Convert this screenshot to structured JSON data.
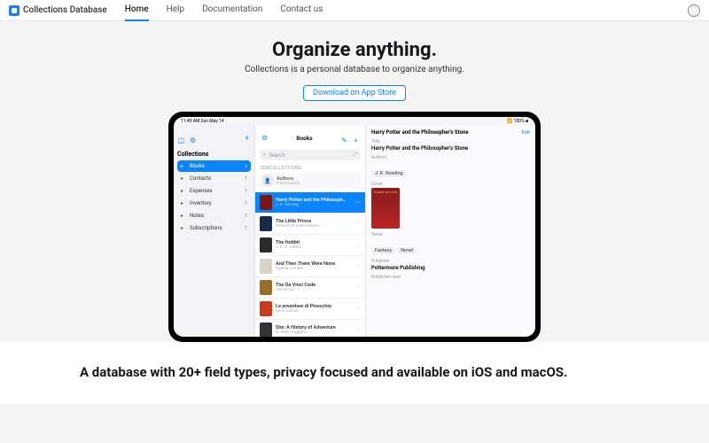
{
  "topbar": {
    "brand": "Collections Database",
    "nav": [
      "Home",
      "Help",
      "Documentation",
      "Contact us"
    ]
  },
  "hero": {
    "headline": "Organize anything.",
    "sub": "Collections is a personal database to organize anything.",
    "cta": "Download on App Store"
  },
  "status": {
    "time": "11:49 AM  Sun May 14",
    "battery": "100%"
  },
  "sidebar": {
    "title": "Collections",
    "items": [
      {
        "label": "Books",
        "count": "6"
      },
      {
        "label": "Contacts",
        "count": "1"
      },
      {
        "label": "Expenses",
        "count": "1"
      },
      {
        "label": "Inventory",
        "count": "1"
      },
      {
        "label": "Notes",
        "count": "1"
      },
      {
        "label": "Subscriptions",
        "count": "1"
      }
    ]
  },
  "mid": {
    "title": "Books",
    "search": "Search",
    "subhdr": "SUBCOLLECTIONS",
    "sub": {
      "name": "Authors",
      "meta": "6 documents"
    },
    "books": [
      {
        "t": "Harry Potter and the Philosoph…",
        "a": "J. K. Rowling",
        "c": "#7a1616"
      },
      {
        "t": "The Little Prince",
        "a": "Antoine de Saint-Exupéry",
        "c": "#1b2a4a"
      },
      {
        "t": "The Hobbit",
        "a": "J. R. R. Tolkien",
        "c": "#2a2a2a"
      },
      {
        "t": "And Then There Were None",
        "a": "Agatha Christie",
        "c": "#d9d4c8"
      },
      {
        "t": "The Da Vinci Code",
        "a": "Dan Brown",
        "c": "#9a6e2a"
      },
      {
        "t": "Le avventure di Pinocchio",
        "a": "Carlo Collodi",
        "c": "#c93a1e"
      },
      {
        "t": "She: A History of Adventure",
        "a": "H. Rider Haggard",
        "c": "#333"
      }
    ]
  },
  "detail": {
    "title": "Harry Potter and the Philosopher's Stone",
    "edit": "Edit",
    "titleLbl": "Title",
    "titleVal": "Harry Potter and the Philosopher's Stone",
    "authLbl": "Authors",
    "authVal": "J. K. Rowling",
    "coverLbl": "Cover",
    "coverText": "HARRY POTTER",
    "genreLbl": "Genre",
    "genres": [
      "Fantasy",
      "Novel"
    ],
    "pubLbl": "Publisher",
    "pubVal": "Pottermore Publishing",
    "dateLbl": "Published date"
  },
  "band2": "A database with 20+ field types, privacy focused and available on iOS and macOS."
}
